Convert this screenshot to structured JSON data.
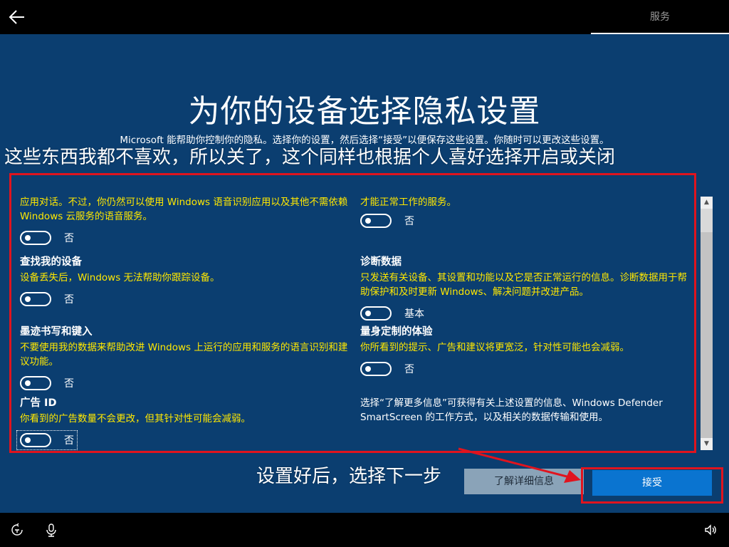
{
  "header": {
    "back_icon": "back-arrow-icon",
    "tab_label": "服务"
  },
  "main": {
    "title": "为你的设备选择隐私设置",
    "subtitle": "Microsoft 能帮助你控制你的隐私。选择你的设置，然后选择“接受”以便保存这些设置。你随时可以更改这些设置。"
  },
  "annotations": {
    "top": "这些东西我都不喜欢，所以关了，这个同样也根据个人喜好选择开启或关闭",
    "bottom": "设置好后，选择下一步",
    "highlight_color": "#e0141e"
  },
  "settings_left": [
    {
      "title": "",
      "desc": "应用对话。不过，你仍然可以使用 Windows 语音识别应用以及其他不需依赖 Windows 云服务的语音服务。",
      "state": "否"
    },
    {
      "title": "查找我的设备",
      "desc": "设备丢失后，Windows 无法帮助你跟踪设备。",
      "state": "否"
    },
    {
      "title": "墨迹书写和键入",
      "desc": "不要使用我的数据来帮助改进 Windows 上运行的应用和服务的语言识别和建议功能。",
      "state": "否"
    },
    {
      "title": "广告 ID",
      "desc": "你看到的广告数量不会更改，但其针对性可能会减弱。",
      "state": "否"
    }
  ],
  "settings_right": [
    {
      "title": "",
      "desc": "才能正常工作的服务。",
      "state": "否"
    },
    {
      "title": "诊断数据",
      "desc": "只发送有关设备、其设置和功能以及它是否正常运行的信息。诊断数据用于帮助保护和及时更新 Windows、解决问题并改进产品。",
      "state": "基本"
    },
    {
      "title": "量身定制的体验",
      "desc": "你所看到的提示、广告和建议将更宽泛，针对性可能也会减弱。",
      "state": "否"
    }
  ],
  "info_text": "选择“了解更多信息”可获得有关上述设置的信息、Windows Defender SmartScreen 的工作方式，以及相关的数据传输和使用。",
  "buttons": {
    "learn_more": "了解详细信息",
    "accept": "接受"
  },
  "colors": {
    "background": "#0b3e70",
    "desc_text": "#ffe800",
    "accept_button": "#0a74d0"
  },
  "footer": {
    "icons": [
      "ease-of-access-icon",
      "microphone-icon",
      "volume-icon"
    ]
  }
}
